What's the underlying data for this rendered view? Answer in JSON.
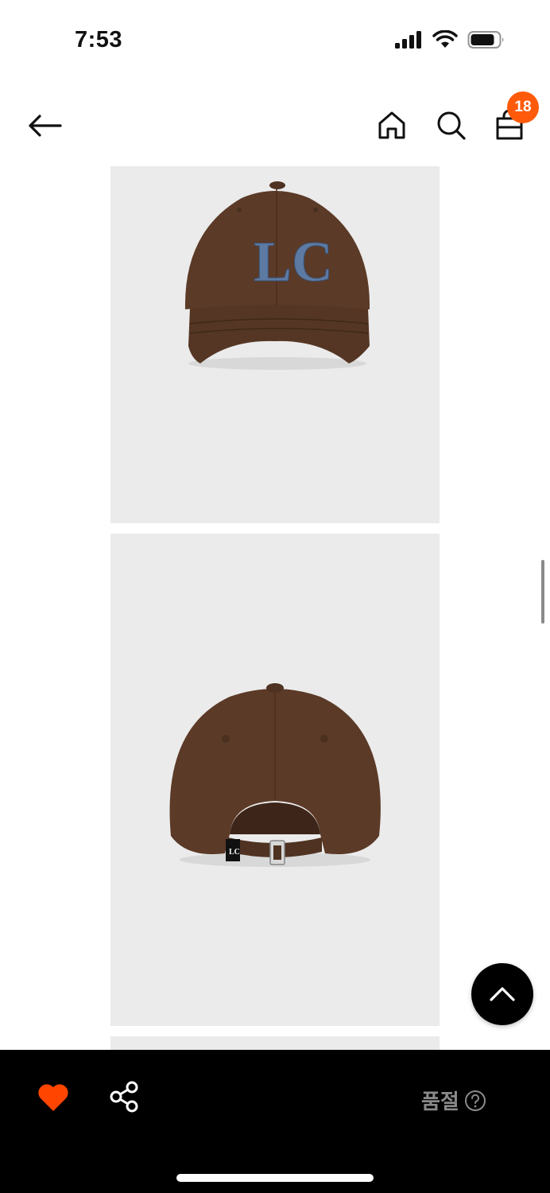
{
  "status_bar": {
    "time": "7:53"
  },
  "header": {
    "cart_count": "18"
  },
  "product": {
    "logo_text": "LC",
    "images": [
      {
        "name": "cap-front"
      },
      {
        "name": "cap-back"
      }
    ],
    "colors": {
      "cap_brown": "#5b3a27",
      "logo_blue": "#5d7aa3",
      "image_bg": "#ebebeb"
    }
  },
  "bottom_bar": {
    "soldout_label": "품절"
  },
  "colors": {
    "accent": "#ff5a0a",
    "bar_bg": "#000000"
  }
}
